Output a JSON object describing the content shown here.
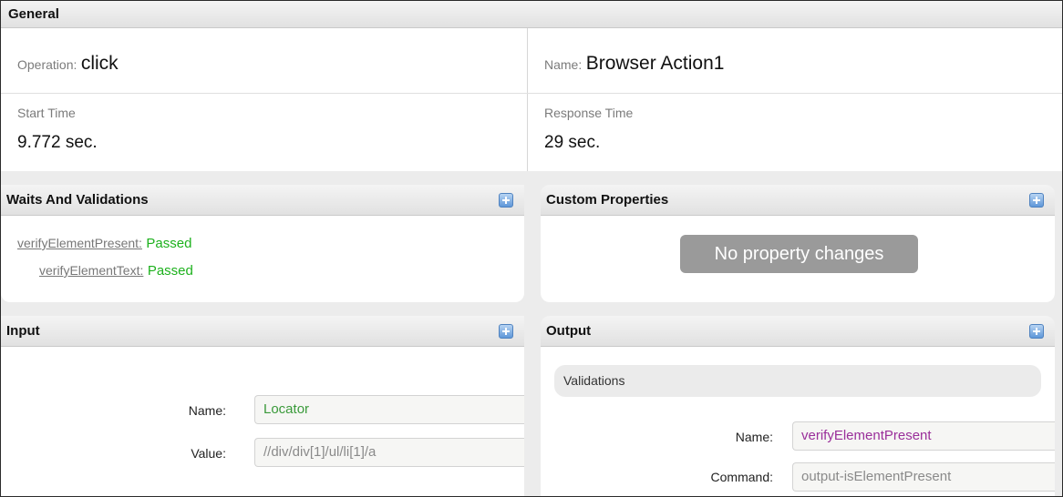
{
  "general": {
    "header": "General",
    "operation_label": "Operation:",
    "operation_value": "click",
    "name_label": "Name:",
    "name_value": "Browser Action1",
    "start_time_label": "Start Time",
    "start_time_value": "9.772 sec.",
    "response_time_label": "Response Time",
    "response_time_value": "29 sec."
  },
  "waits": {
    "header": "Waits And Validations",
    "items": [
      {
        "name": "verifyElementPresent:",
        "status": "Passed"
      },
      {
        "name": "verifyElementText:",
        "status": "Passed"
      }
    ]
  },
  "custom": {
    "header": "Custom Properties",
    "empty_text": "No property changes"
  },
  "input": {
    "header": "Input",
    "name_label": "Name:",
    "name_value": "Locator",
    "value_label": "Value:",
    "value_value": "//div/div[1]/ul/li[1]/a"
  },
  "output": {
    "header": "Output",
    "validations_label": "Validations",
    "name_label": "Name:",
    "name_value": "verifyElementPresent",
    "command_label": "Command:",
    "command_value": "output-isElementPresent"
  },
  "colors": {
    "passed": "#1db11d",
    "locator_text": "#3a9a3a",
    "output_name_text": "#9a2f9a",
    "badge_bg": "#9a9a9a",
    "add_button": "#5f97d8"
  },
  "icons": {
    "add": "plus-square-icon"
  }
}
